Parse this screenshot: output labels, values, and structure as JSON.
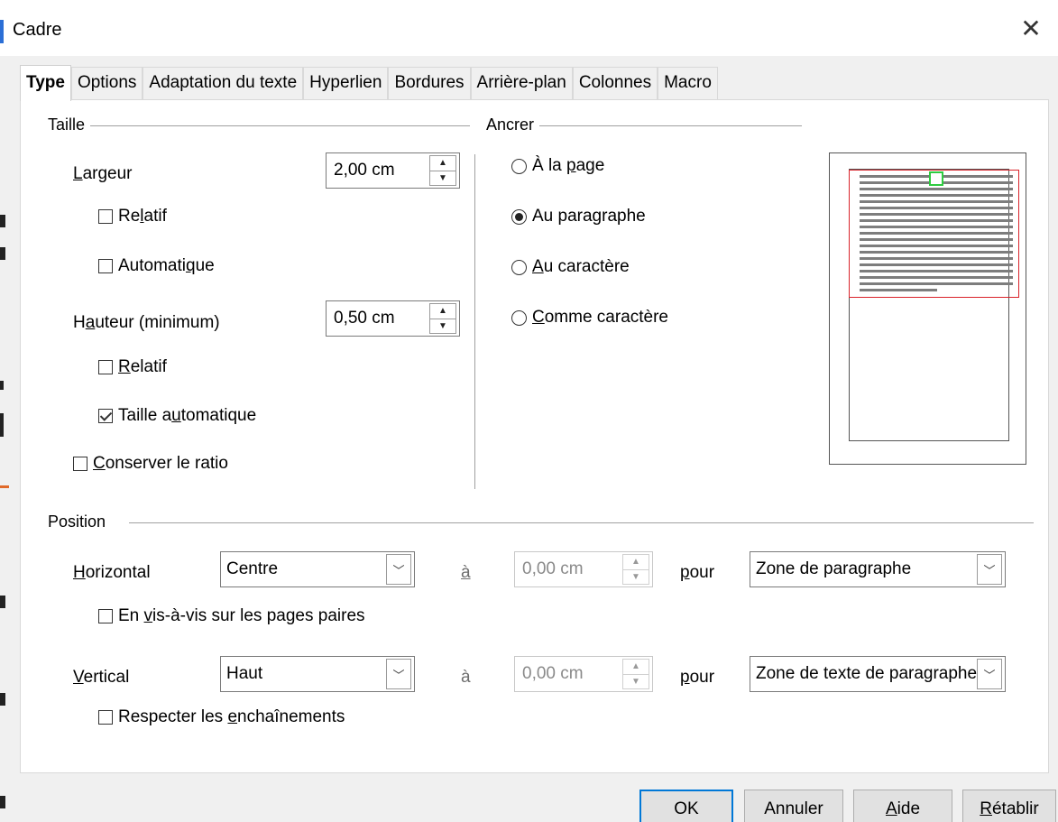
{
  "window": {
    "title": "Cadre"
  },
  "tabs": [
    "Type",
    "Options",
    "Adaptation du texte",
    "Hyperlien",
    "Bordures",
    "Arrière-plan",
    "Colonnes",
    "Macro"
  ],
  "active_tab": "Type",
  "size": {
    "title": "Taille",
    "width_label": "Largeur",
    "width_value": "2,00 cm",
    "width_relative_label": "Relatif",
    "width_relative_checked": false,
    "width_auto_label": "Automatique",
    "width_auto_checked": false,
    "height_label": "Hauteur (minimum)",
    "height_value": "0,50 cm",
    "height_relative_label": "Relatif",
    "height_relative_checked": false,
    "height_auto_label": "Taille automatique",
    "height_auto_checked": true,
    "keep_ratio_label": "Conserver le ratio",
    "keep_ratio_checked": false
  },
  "anchor": {
    "title": "Ancrer",
    "options": [
      "À la page",
      "Au paragraphe",
      "Au caractère",
      "Comme caractère"
    ],
    "selected": "Au paragraphe"
  },
  "position": {
    "title": "Position",
    "horizontal_label": "Horizontal",
    "horizontal_value": "Centre",
    "horizontal_at_label": "à",
    "horizontal_offset": "0,00 cm",
    "horizontal_for_label": "pour",
    "horizontal_relative_to": "Zone de paragraphe",
    "mirror_label": "En vis-à-vis sur les pages paires",
    "mirror_checked": false,
    "vertical_label": "Vertical",
    "vertical_value": "Haut",
    "vertical_at_label": "à",
    "vertical_offset": "0,00 cm",
    "vertical_for_label": "pour",
    "vertical_relative_to": "Zone de texte de paragraphe",
    "follow_flow_label": "Respecter les enchaînements",
    "follow_flow_checked": false
  },
  "buttons": {
    "ok": "OK",
    "cancel": "Annuler",
    "help": "Aide",
    "reset": "Rétablir"
  },
  "colors": {
    "accent": "#0078d7",
    "preview_area": "#d9232a",
    "preview_frame": "#2ecc40"
  }
}
